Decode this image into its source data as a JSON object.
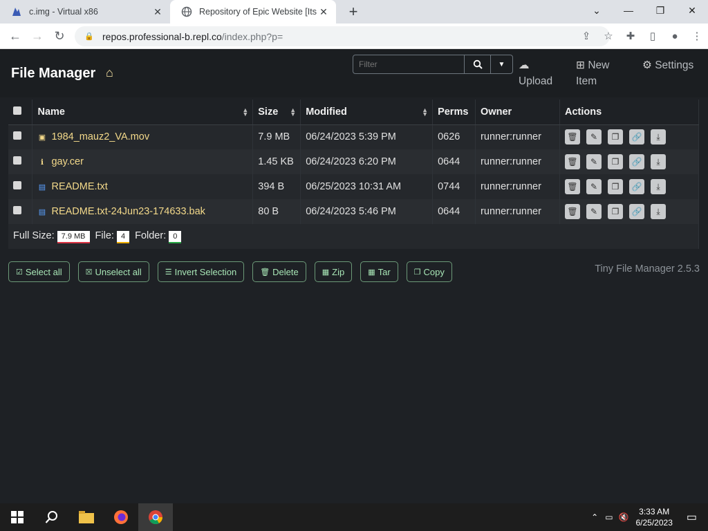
{
  "browser": {
    "tabs": [
      {
        "title": "c.img - Virtual x86",
        "active": false
      },
      {
        "title": "Repository of Epic Website [Its fr",
        "active": true
      }
    ],
    "url_host": "repos.professional-b.repl.co",
    "url_path": "/index.php?p="
  },
  "app": {
    "brand": "File Manager",
    "filter_placeholder": "Filter",
    "upload_label": "Upload",
    "new_item_label": "New Item",
    "settings_label": "Settings"
  },
  "table": {
    "headers": {
      "name": "Name",
      "size": "Size",
      "modified": "Modified",
      "perms": "Perms",
      "owner": "Owner",
      "actions": "Actions"
    },
    "rows": [
      {
        "icon": "video-file-icon",
        "name": "1984_mauz2_VA.mov",
        "size": "7.9 MB",
        "modified": "06/24/2023 5:39 PM",
        "perms": "0626",
        "owner": "runner:runner"
      },
      {
        "icon": "info-icon",
        "name": "gay.cer",
        "size": "1.45 KB",
        "modified": "06/24/2023 6:20 PM",
        "perms": "0644",
        "owner": "runner:runner"
      },
      {
        "icon": "text-file-icon",
        "name": "README.txt",
        "size": "394 B",
        "modified": "06/25/2023 10:31 AM",
        "perms": "0744",
        "owner": "runner:runner"
      },
      {
        "icon": "text-file-icon",
        "name": "README.txt-24Jun23-174633.bak",
        "size": "80 B",
        "modified": "06/24/2023 5:46 PM",
        "perms": "0644",
        "owner": "runner:runner"
      }
    ],
    "footer": {
      "full_size_label": "Full Size:",
      "full_size": "7.9 MB",
      "file_label": "File:",
      "file_count": "4",
      "folder_label": "Folder:",
      "folder_count": "0"
    }
  },
  "actions": {
    "select_all": "Select all",
    "unselect_all": "Unselect all",
    "invert": "Invert Selection",
    "delete": "Delete",
    "zip": "Zip",
    "tar": "Tar",
    "copy": "Copy"
  },
  "version": "Tiny File Manager 2.5.3",
  "taskbar": {
    "time": "3:33 AM",
    "date": "6/25/2023"
  }
}
